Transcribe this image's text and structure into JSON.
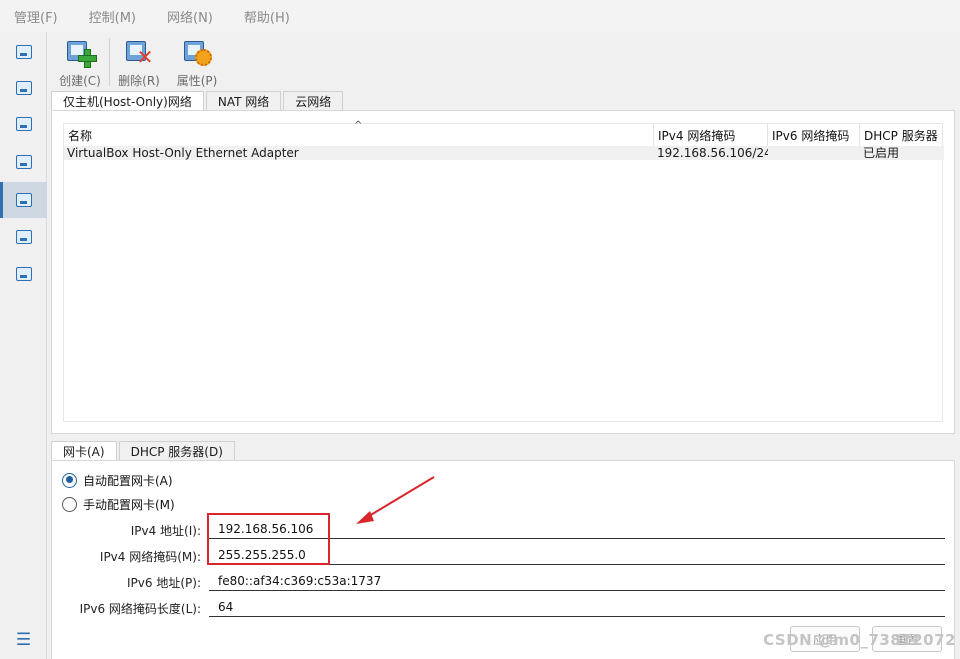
{
  "menu": [
    "管理(F)",
    "控制(M)",
    "网络(N)",
    "帮助(H)"
  ],
  "toolbar": {
    "create": "创建(C)",
    "delete": "删除(R)",
    "properties": "属性(P)"
  },
  "top_tabs": [
    "仅主机(Host-Only)网络",
    "NAT 网络",
    "云网络"
  ],
  "table": {
    "sort_indicator": "^",
    "headers": [
      "名称",
      "IPv4 网络掩码",
      "IPv6 网络掩码",
      "DHCP 服务器"
    ],
    "rows": [
      [
        "VirtualBox Host-Only Ethernet Adapter",
        "192.168.56.106/24",
        "",
        "已启用"
      ]
    ]
  },
  "bottom_tabs": [
    "网卡(A)",
    "DHCP 服务器(D)"
  ],
  "adapter": {
    "auto_config": "自动配置网卡(A)",
    "manual_config": "手动配置网卡(M)",
    "ipv4_addr_label": "IPv4 地址(I):",
    "ipv4_addr_value": "192.168.56.106",
    "ipv4_mask_label": "IPv4 网络掩码(M):",
    "ipv4_mask_value": "255.255.255.0",
    "ipv6_addr_label": "IPv6 地址(P):",
    "ipv6_addr_value": "fe80::af34:c369:c53a:1737",
    "ipv6_len_label": "IPv6 网络掩码长度(L):",
    "ipv6_len_value": "64"
  },
  "buttons": {
    "apply": "应用",
    "reset": "重置"
  },
  "watermark": "CSDN @m0_73812072",
  "colors": {
    "accent": "#1f5f9e",
    "annotation": "#d9262b"
  }
}
